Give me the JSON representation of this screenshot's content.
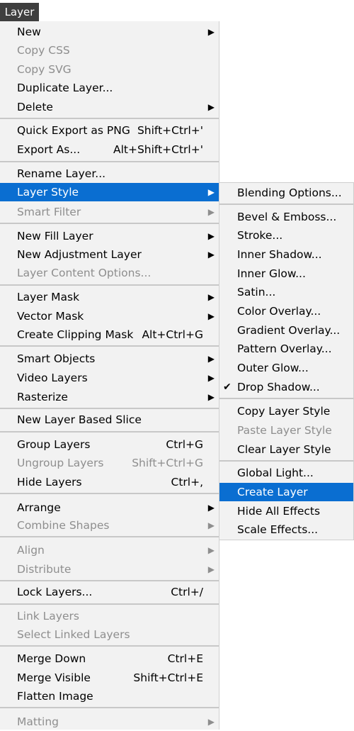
{
  "menubar": {
    "title": "Layer"
  },
  "main": {
    "new": "New",
    "copy_css": "Copy CSS",
    "copy_svg": "Copy SVG",
    "duplicate_layer": "Duplicate Layer...",
    "delete": "Delete",
    "quick_export": "Quick Export as PNG",
    "quick_export_shortcut": "Shift+Ctrl+'",
    "export_as": "Export As...",
    "export_as_shortcut": "Alt+Shift+Ctrl+'",
    "rename_layer": "Rename Layer...",
    "layer_style": "Layer Style",
    "smart_filter": "Smart Filter",
    "new_fill_layer": "New Fill Layer",
    "new_adjustment_layer": "New Adjustment Layer",
    "layer_content_options": "Layer Content Options...",
    "layer_mask": "Layer Mask",
    "vector_mask": "Vector Mask",
    "create_clipping_mask": "Create Clipping Mask",
    "create_clipping_mask_shortcut": "Alt+Ctrl+G",
    "smart_objects": "Smart Objects",
    "video_layers": "Video Layers",
    "rasterize": "Rasterize",
    "new_layer_based_slice": "New Layer Based Slice",
    "group_layers": "Group Layers",
    "group_layers_shortcut": "Ctrl+G",
    "ungroup_layers": "Ungroup Layers",
    "ungroup_layers_shortcut": "Shift+Ctrl+G",
    "hide_layers": "Hide Layers",
    "hide_layers_shortcut": "Ctrl+,",
    "arrange": "Arrange",
    "combine_shapes": "Combine Shapes",
    "align": "Align",
    "distribute": "Distribute",
    "lock_layers": "Lock Layers...",
    "lock_layers_shortcut": "Ctrl+/",
    "link_layers": "Link Layers",
    "select_linked_layers": "Select Linked Layers",
    "merge_down": "Merge Down",
    "merge_down_shortcut": "Ctrl+E",
    "merge_visible": "Merge Visible",
    "merge_visible_shortcut": "Shift+Ctrl+E",
    "flatten_image": "Flatten Image",
    "matting": "Matting",
    "arrow": "▶"
  },
  "submenu": {
    "blending_options": "Blending Options...",
    "bevel_emboss": "Bevel & Emboss...",
    "stroke": "Stroke...",
    "inner_shadow": "Inner Shadow...",
    "inner_glow": "Inner Glow...",
    "satin": "Satin...",
    "color_overlay": "Color Overlay...",
    "gradient_overlay": "Gradient Overlay...",
    "pattern_overlay": "Pattern Overlay...",
    "outer_glow": "Outer Glow...",
    "drop_shadow": "Drop Shadow...",
    "drop_shadow_check": "✔",
    "copy_layer_style": "Copy Layer Style",
    "paste_layer_style": "Paste Layer Style",
    "clear_layer_style": "Clear Layer Style",
    "global_light": "Global Light...",
    "create_layer": "Create Layer",
    "hide_all_effects": "Hide All Effects",
    "scale_effects": "Scale Effects..."
  },
  "colors": {
    "highlight": "#0a6ed1",
    "menu_bg": "#f2f2f2",
    "title_bg": "#3f3f3f",
    "disabled_text": "#8e8e8e"
  }
}
